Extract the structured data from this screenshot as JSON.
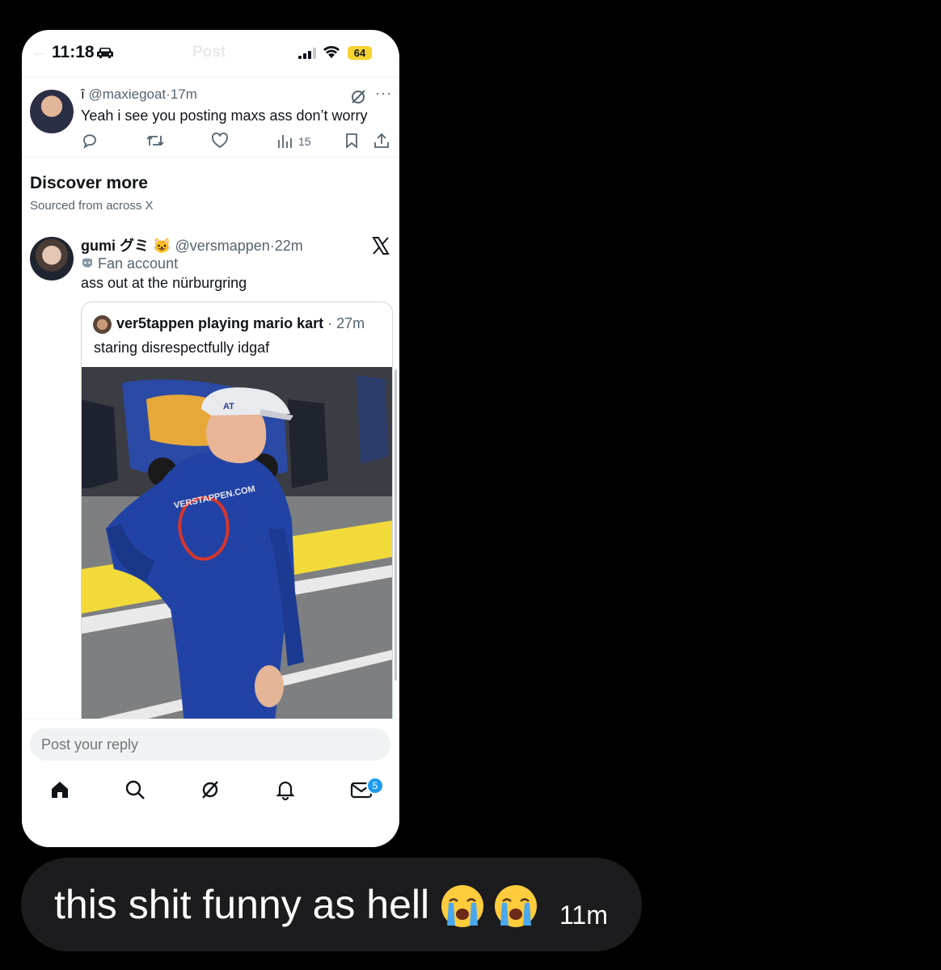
{
  "status_bar": {
    "time": "11:18",
    "battery": "64",
    "faded_title": "Post"
  },
  "reply_tweet": {
    "name": "î",
    "handle": "@maxiegoat",
    "time": "17m",
    "text": "Yeah i see you posting maxs ass don’t worry",
    "views": "15"
  },
  "discover": {
    "title": "Discover more",
    "subtitle": "Sourced from across X"
  },
  "post": {
    "name": "gumi グミ",
    "name_emoji": "😺",
    "handle": "@versmappen",
    "time": "22m",
    "badge": "Fan account",
    "text": "ass out at the nürburgring",
    "quote": {
      "name": "ver5tappen playing mario kart",
      "time": "27m",
      "text": "staring disrespectfully idgaf"
    }
  },
  "reply_input": {
    "placeholder": "Post your reply"
  },
  "tabbar": {
    "messages_badge": "5"
  },
  "message": {
    "text": "this shit funny as hell",
    "emoji": "😭",
    "time": "11m"
  }
}
